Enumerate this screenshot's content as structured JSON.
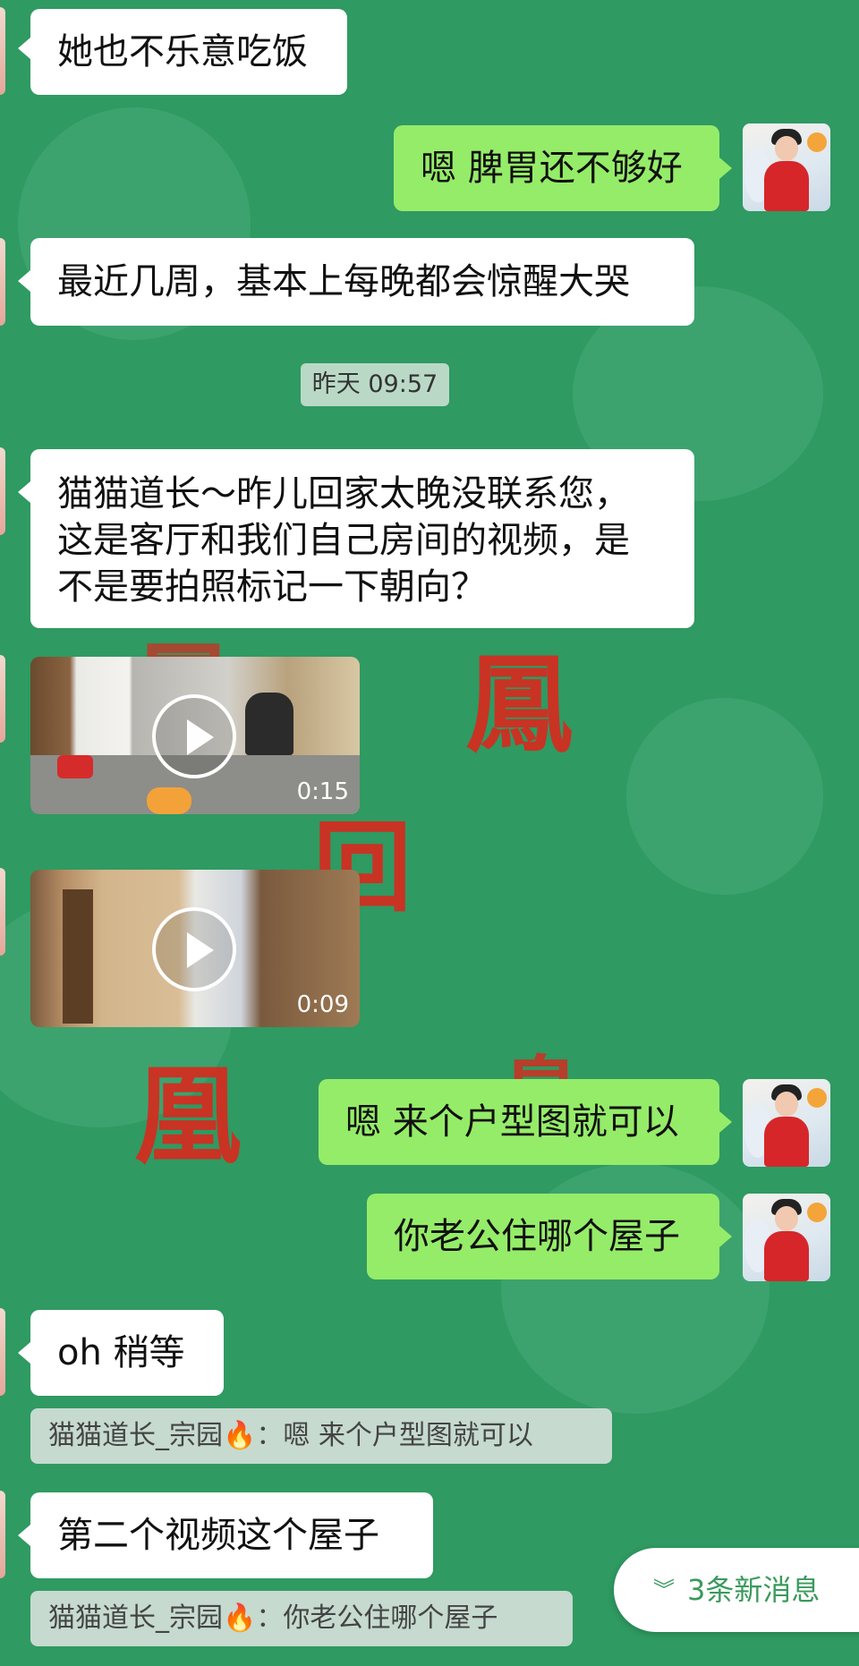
{
  "chat": {
    "messages": [
      {
        "text": "她也不乐意吃饭"
      },
      {
        "text": "嗯 脾胃还不够好"
      },
      {
        "text": "最近几周，基本上每晚都会惊醒大哭"
      },
      {
        "timestamp": "昨天 09:57"
      },
      {
        "text_lines": [
          "猫猫道长～昨儿回家太晚没联系您，",
          "这是客厅和我们自己房间的视频，是",
          "不是要拍照标记一下朝向？"
        ]
      },
      {
        "video_duration": "0:15"
      },
      {
        "video_duration": "0:09"
      },
      {
        "text": "嗯 来个户型图就可以"
      },
      {
        "text": "你老公住哪个屋子"
      },
      {
        "text": "oh 稍等"
      },
      {
        "quote": "猫猫道长_宗园🔥：嗯 来个户型图就可以"
      },
      {
        "text": "第二个视频这个屋子"
      },
      {
        "quote": "猫猫道长_宗园🔥：你老公住哪个屋子"
      }
    ]
  },
  "new_messages": {
    "label": "3条新消息",
    "icon": "double-chevron-down-icon"
  },
  "colors": {
    "background": "#2f9a62",
    "outgoing": "#95ec69",
    "incoming": "#ffffff",
    "accent": "#3a9a5c"
  }
}
